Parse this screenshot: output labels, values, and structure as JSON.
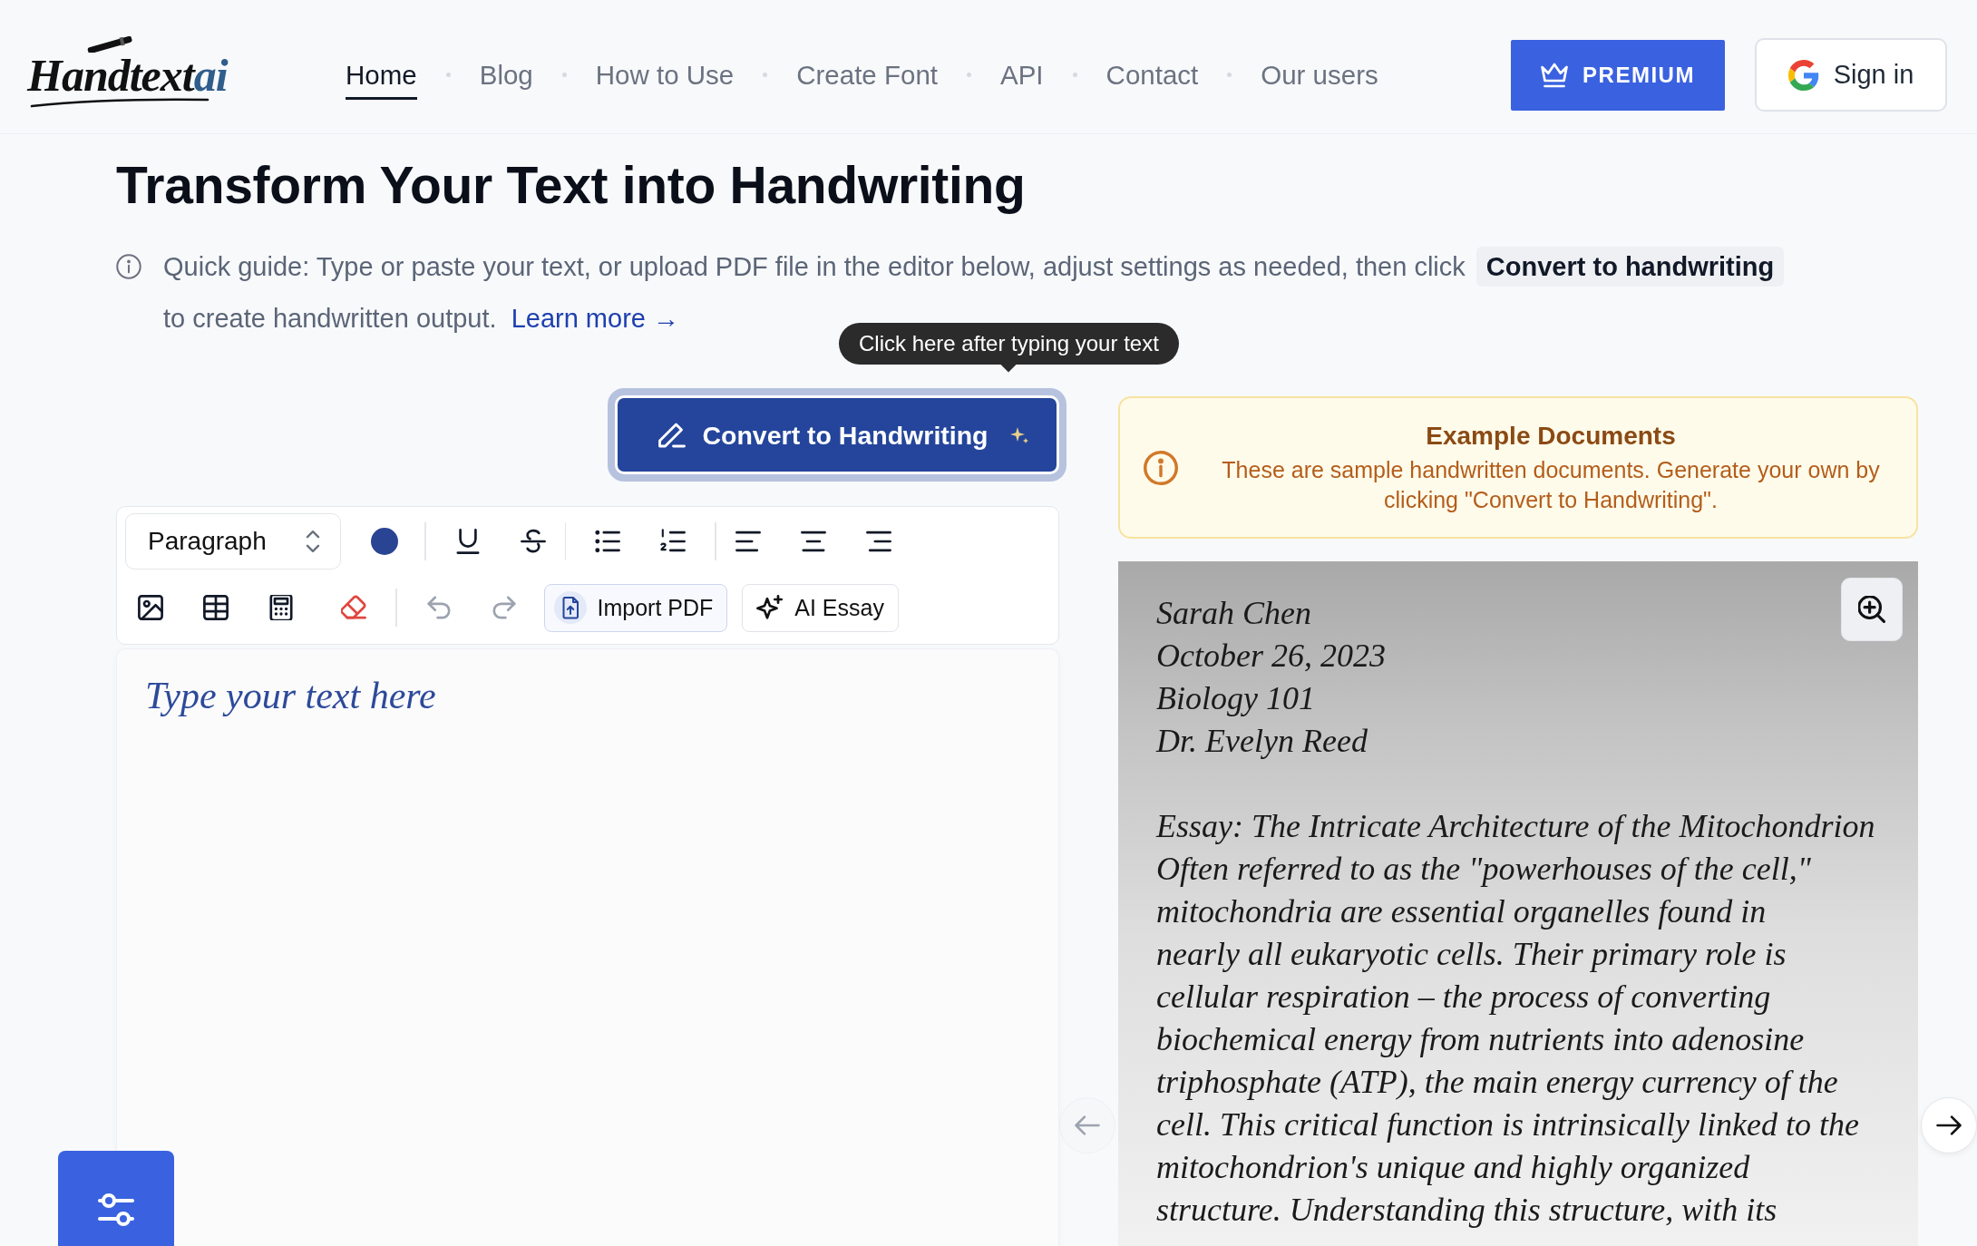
{
  "header": {
    "logo": {
      "text": "Handtext",
      "accent": "ai"
    },
    "nav": [
      {
        "label": "Home",
        "selected": true
      },
      {
        "label": "Blog",
        "selected": false
      },
      {
        "label": "How to Use",
        "selected": false
      },
      {
        "label": "Create Font",
        "selected": false
      },
      {
        "label": "API",
        "selected": false
      },
      {
        "label": "Contact",
        "selected": false
      },
      {
        "label": "Our users",
        "selected": false
      }
    ],
    "premium_button": "PREMIUM",
    "sign_in_button": "Sign in"
  },
  "intro": {
    "title": "Transform Your Text into Handwriting",
    "guide": {
      "text": "Quick guide: Type or paste your text, or upload PDF file in the editor below, adjust settings as needed, then click",
      "highlight": "Convert to handwriting",
      "continuation": "to create handwritten output.",
      "link": "Learn more →"
    }
  },
  "convert": {
    "tooltip": "Click here after typing your text",
    "button": "Convert to Handwriting"
  },
  "editor": {
    "toolbar": {
      "block_format": "Paragraph",
      "undo": {
        "disabled": true
      },
      "redo": {
        "disabled": true
      },
      "import_button": "Import PDF",
      "essay_button": "AI Essay"
    },
    "placeholder": "Type your text here"
  },
  "examples": {
    "notice": {
      "title": "Example Documents",
      "text": "These are sample handwritten documents. Generate your own by clicking \"Convert to Handwriting\"."
    },
    "document": {
      "heading_lines": [
        "Sarah Chen",
        "October 26, 2023",
        "Biology 101",
        "Dr. Evelyn Reed"
      ],
      "body_lines": [
        "Essay: The Intricate Architecture of the Mitochondrion",
        "Often referred to as the \"powerhouses of the cell,\"",
        "mitochondria are essential organelles found in",
        "nearly all eukaryotic cells. Their primary role is",
        "cellular respiration – the process of converting",
        "biochemical energy from nutrients into adenosine",
        "triphosphate (ATP), the main energy currency of the",
        "cell. This critical function is intrinsically linked to the",
        "mitochondrion's unique and highly organized",
        "structure. Understanding this structure, with its"
      ]
    },
    "prev_button": {
      "disabled": true
    },
    "next_button": {
      "disabled": false
    }
  }
}
